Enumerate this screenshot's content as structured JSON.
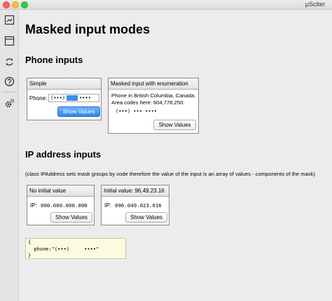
{
  "window": {
    "title": "μSciter"
  },
  "sidebar": {
    "items": [
      {
        "icon": "image-icon"
      },
      {
        "icon": "window-icon"
      },
      {
        "icon": "refresh-icon"
      },
      {
        "icon": "help-icon"
      },
      {
        "icon": "settings-icon"
      }
    ]
  },
  "page": {
    "title": "Masked input modes"
  },
  "phone_section": {
    "heading": "Phone inputs",
    "simple": {
      "title": "Simple",
      "label": "Phone:",
      "value_left": "(•••)",
      "value_right": "••••",
      "button": "Show Values"
    },
    "enum": {
      "title": "Masked input with enumeration",
      "text1": "Phone in British Columbia, Canada.",
      "text2": "Area codes here: 604,778,250:",
      "value": "(•••) ••• ••••",
      "button": "Show Values"
    }
  },
  "ip_section": {
    "heading": "IP address inputs",
    "note": "(class IPAddress sets mask groups by code therefore the value of the input is an array of values - components of the mask)",
    "no_initial": {
      "title": "No initial value",
      "label": "IP:",
      "value": "000.000.000.000",
      "button": "Show Values"
    },
    "initial": {
      "title": "Initial value: 96.49.23.16",
      "label": "IP:",
      "value": "096.049.023.016",
      "button": "Show Values"
    }
  },
  "output": {
    "line1": "{",
    "line2": "  phone:\"(•••)     ••••\"",
    "line3": "}"
  }
}
